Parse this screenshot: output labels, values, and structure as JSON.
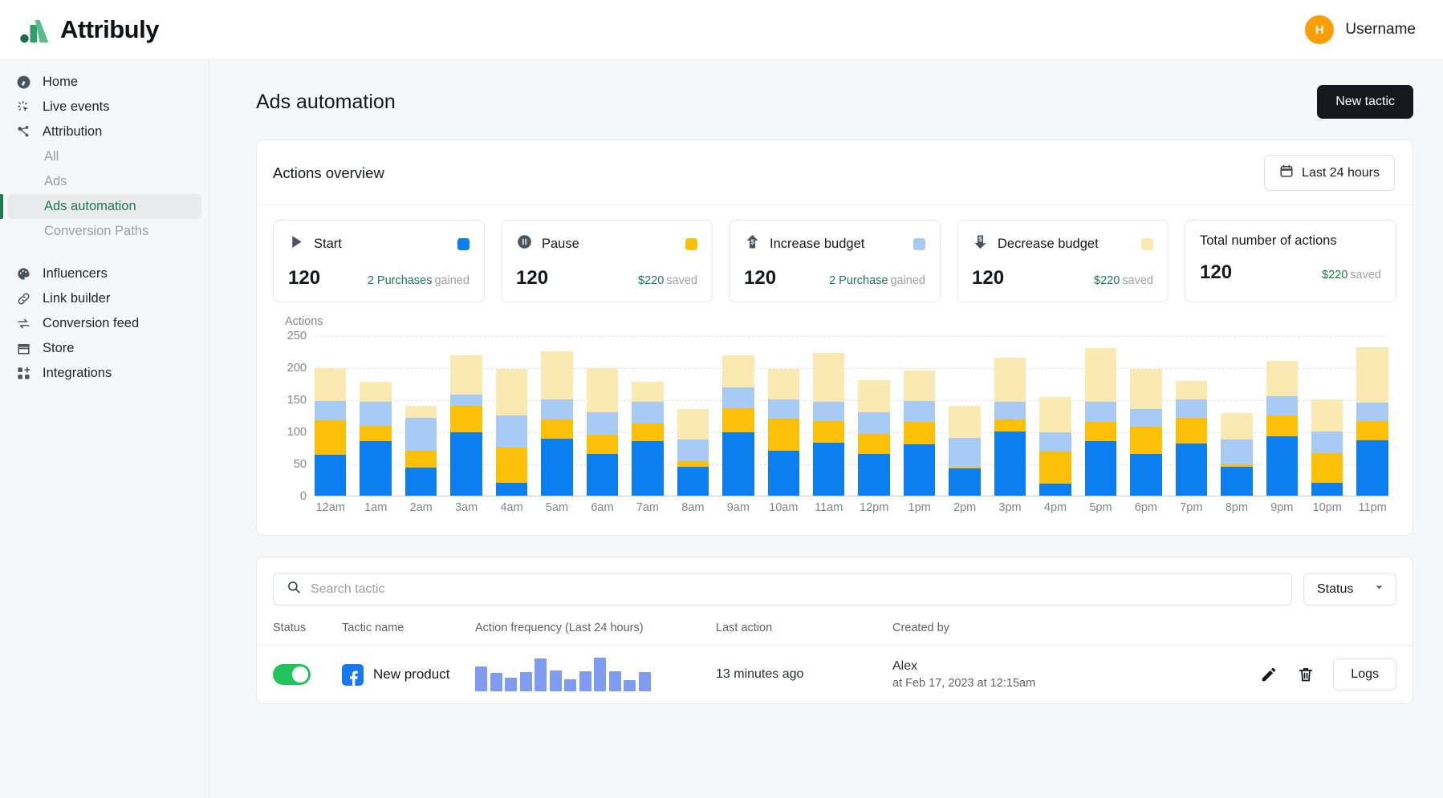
{
  "brand": {
    "name": "Attribuly",
    "green_dark": "#1c6b45",
    "green_mid": "#2f9e68",
    "green_light": "#5cbd8a"
  },
  "topbar": {
    "avatar_initial": "H",
    "username": "Username",
    "avatar_color": "#fb9e07"
  },
  "sidebar": {
    "items": [
      {
        "label": "Home",
        "icon": "dashboard-icon"
      },
      {
        "label": "Live events",
        "icon": "cursor-click-icon"
      },
      {
        "label": "Attribution",
        "icon": "node-graph-icon"
      }
    ],
    "attribution_children": [
      {
        "label": "All",
        "active": false
      },
      {
        "label": "Ads",
        "active": false
      },
      {
        "label": "Ads automation",
        "active": true
      },
      {
        "label": "Conversion Paths",
        "active": false
      }
    ],
    "items_bottom": [
      {
        "label": "Influencers",
        "icon": "palette-icon"
      },
      {
        "label": "Link builder",
        "icon": "link-icon"
      },
      {
        "label": "Conversion feed",
        "icon": "swap-arrows-icon"
      },
      {
        "label": "Store",
        "icon": "storefront-icon"
      },
      {
        "label": "Integrations",
        "icon": "grid-plus-icon"
      }
    ],
    "active_color": "#1f7a4d"
  },
  "page": {
    "title": "Ads automation",
    "new_tactic_label": "New tactic"
  },
  "overview": {
    "title": "Actions overview",
    "date_range_label": "Last 24 hours",
    "cards": [
      {
        "name": "Start",
        "icon": "play-icon",
        "swatch": "#0b7ff0",
        "value": "120",
        "note_main": "2 Purchases",
        "note_sub": "gained"
      },
      {
        "name": "Pause",
        "icon": "pause-circle-icon",
        "swatch": "#fcc008",
        "value": "120",
        "note_main": "$220",
        "note_sub": "saved"
      },
      {
        "name": "Increase budget",
        "icon": "dollar-up-arrow-icon",
        "swatch": "#a8cbf5",
        "value": "120",
        "note_main": "2 Purchase",
        "note_sub": "gained"
      },
      {
        "name": "Decrease budget",
        "icon": "dollar-down-arrow-icon",
        "swatch": "#fae9b0",
        "value": "120",
        "note_main": "$220",
        "note_sub": "saved"
      },
      {
        "name": "Total number of actions",
        "icon": "none",
        "swatch": "none",
        "value": "120",
        "note_main": "$220",
        "note_sub": "saved"
      }
    ]
  },
  "chart_data": {
    "type": "bar",
    "stacked": true,
    "title": "",
    "xlabel": "",
    "ylabel": "Actions",
    "ylim": [
      0,
      250
    ],
    "yticks": [
      0,
      50,
      100,
      150,
      200,
      250
    ],
    "grid": true,
    "legend_position": "cards-above",
    "categories": [
      "12am",
      "1am",
      "2am",
      "3am",
      "4am",
      "5am",
      "6am",
      "7am",
      "8am",
      "9am",
      "10am",
      "11am",
      "12pm",
      "1pm",
      "2pm",
      "3pm",
      "4pm",
      "5pm",
      "6pm",
      "7pm",
      "8pm",
      "9pm",
      "10pm",
      "11pm"
    ],
    "series": [
      {
        "name": "Start",
        "color": "#0b7ff0",
        "values": [
          63,
          85,
          43,
          98,
          20,
          88,
          64,
          84,
          45,
          98,
          70,
          82,
          65,
          80,
          42,
          100,
          18,
          84,
          65,
          81,
          45,
          92,
          20,
          86
        ]
      },
      {
        "name": "Pause",
        "color": "#fcc008",
        "values": [
          54,
          23,
          27,
          41,
          54,
          30,
          31,
          28,
          8,
          38,
          50,
          34,
          31,
          34,
          2,
          18,
          50,
          30,
          42,
          40,
          3,
          32,
          46,
          30
        ]
      },
      {
        "name": "Increase budget",
        "color": "#a8cbf5",
        "values": [
          30,
          38,
          51,
          18,
          51,
          32,
          35,
          34,
          34,
          32,
          30,
          30,
          33,
          33,
          46,
          28,
          30,
          32,
          27,
          29,
          39,
          30,
          33,
          28
        ]
      },
      {
        "name": "Decrease budget",
        "color": "#fae9b0",
        "values": [
          51,
          31,
          18,
          61,
          72,
          75,
          68,
          31,
          48,
          50,
          47,
          76,
          51,
          47,
          50,
          68,
          55,
          84,
          63,
          28,
          41,
          56,
          50,
          87
        ]
      }
    ]
  },
  "table": {
    "search_placeholder": "Search tactic",
    "search_value": "",
    "status_filter_label": "Status",
    "columns": [
      "Status",
      "Tactic name",
      "Action frequency (Last 24 hours)",
      "Last action",
      "Created by",
      ""
    ],
    "rows": [
      {
        "enabled": true,
        "platform": "facebook",
        "tactic_name": "New product",
        "frequency": [
          30,
          22,
          17,
          23,
          40,
          25,
          15,
          24,
          41,
          24,
          14,
          23
        ],
        "frequency_color": "#7f9cf0",
        "last_action": "13 minutes ago",
        "created_by": "Alex",
        "created_at": "at Feb 17, 2023 at 12:15am",
        "edit_label": "edit",
        "delete_label": "delete",
        "logs_label": "Logs"
      }
    ]
  }
}
